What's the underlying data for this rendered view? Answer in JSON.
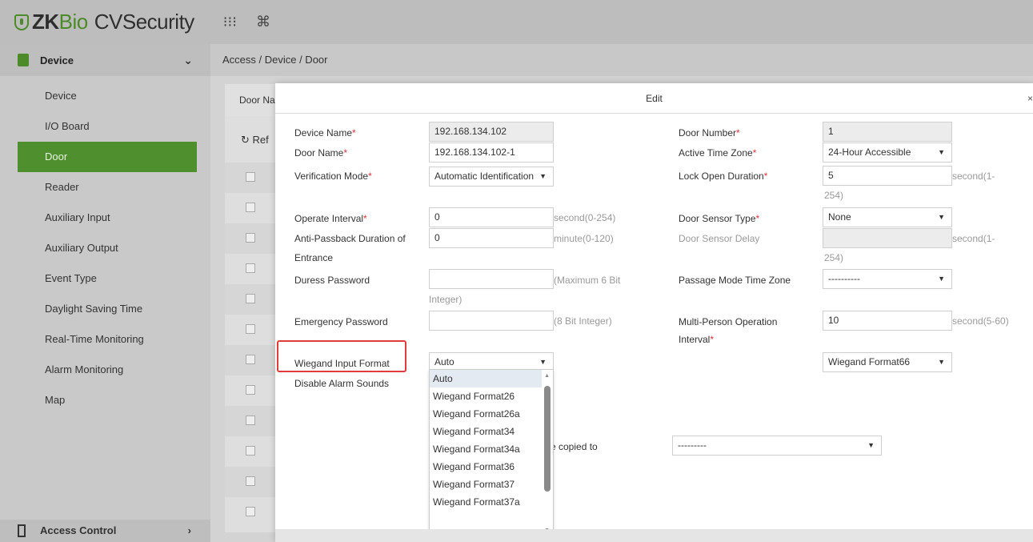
{
  "app": {
    "brand_zk": "ZK",
    "brand_bio": "Bio",
    "brand_rest": "CVSecurity"
  },
  "topbar": {
    "apps_icon": "⁝⁝⁝",
    "cmd_icon": "⌘"
  },
  "sidebar": {
    "section_title": "Device",
    "items": [
      {
        "label": "Device"
      },
      {
        "label": "I/O Board"
      },
      {
        "label": "Door"
      },
      {
        "label": "Reader"
      },
      {
        "label": "Auxiliary Input"
      },
      {
        "label": "Auxiliary Output"
      },
      {
        "label": "Event Type"
      },
      {
        "label": "Daylight Saving Time"
      },
      {
        "label": "Real-Time Monitoring"
      },
      {
        "label": "Alarm Monitoring"
      },
      {
        "label": "Map"
      }
    ],
    "active_item": "Door",
    "footer_section": "Access Control"
  },
  "main": {
    "breadcrumb": "Access / Device / Door",
    "filter_label": "Door Na",
    "refresh_label": "Ref"
  },
  "modal": {
    "title": "Edit",
    "close": "×",
    "fields": {
      "device_name": {
        "label": "Device Name",
        "value": "192.168.134.102"
      },
      "door_name": {
        "label": "Door Name",
        "value": "192.168.134.102-1"
      },
      "verification_mode": {
        "label": "Verification Mode",
        "value": "Automatic Identification"
      },
      "operate_interval": {
        "label": "Operate Interval",
        "value": "0",
        "hint": "second(0-254)"
      },
      "anti_passback_1": "Anti-Passback Duration of",
      "anti_passback_2": "Entrance",
      "anti_passback_value": "0",
      "anti_passback_hint": "minute(0-120)",
      "duress_password": {
        "label": "Duress Password",
        "value": "",
        "hint_1": "(Maximum 6 Bit",
        "hint_2": "Integer)"
      },
      "emergency_password": {
        "label": "Emergency Password",
        "value": "",
        "hint": "(8 Bit Integer)"
      },
      "wiegand_input_format": {
        "label": "Wiegand Input Format",
        "value": "Auto"
      },
      "disable_alarm_sounds": {
        "label": "Disable Alarm Sounds"
      },
      "copied_to": {
        "label": "e copied to",
        "value": "---------"
      },
      "door_number": {
        "label": "Door Number",
        "value": "1"
      },
      "active_time_zone": {
        "label": "Active Time Zone",
        "value": "24-Hour Accessible"
      },
      "lock_open_duration": {
        "label": "Lock Open Duration",
        "value": "5",
        "hint_1": "second(1-",
        "hint_2": "254)"
      },
      "door_sensor_type": {
        "label": "Door Sensor Type",
        "value": "None"
      },
      "door_sensor_delay": {
        "label": "Door Sensor Delay",
        "value": "",
        "hint_1": "second(1-",
        "hint_2": "254)"
      },
      "passage_mode_time_zone": {
        "label": "Passage Mode Time Zone",
        "value": "----------"
      },
      "multi_person_1": "Multi-Person Operation",
      "multi_person_2": "Interval",
      "multi_person_value": "10",
      "multi_person_hint": "second(5-60)",
      "wiegand_output_format": {
        "value": "Wiegand Format66"
      }
    },
    "dropdown_options": [
      "Auto",
      "Wiegand Format26",
      "Wiegand Format26a",
      "Wiegand Format34",
      "Wiegand Format34a",
      "Wiegand Format36",
      "Wiegand Format37",
      "Wiegand Format37a"
    ],
    "required_mark": "*",
    "highlight_color": "#e23b3b"
  },
  "colors": {
    "accent": "#4f8f2e",
    "topbar": "#bdbdbd",
    "sidebar": "#c9c9c9"
  }
}
